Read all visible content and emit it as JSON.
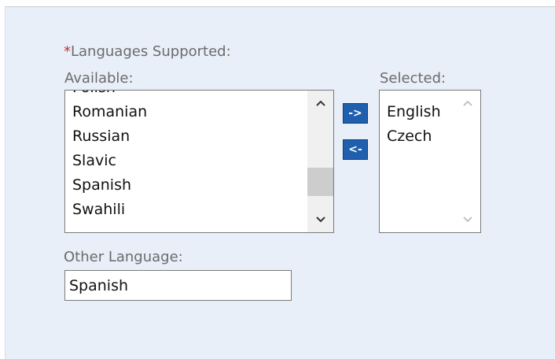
{
  "form": {
    "required_marker": "*",
    "languages_label": "Languages Supported:",
    "available_label": "Available:",
    "selected_label": "Selected:",
    "other_language_label": "Other Language:",
    "other_language_value": "Spanish"
  },
  "available": {
    "items": [
      "Polish",
      "Romanian",
      "Russian",
      "Slavic",
      "Spanish",
      "Swahili"
    ]
  },
  "selected": {
    "items": [
      "English",
      "Czech"
    ]
  },
  "buttons": {
    "move_right_label": "->",
    "move_left_label": "<-"
  },
  "icons": {
    "scroll_up": "chevron-up-icon",
    "scroll_down": "chevron-down-icon"
  },
  "colors": {
    "panel_bg": "#e8eff9",
    "button_bg": "#1f5fae",
    "required": "#c9302c"
  }
}
